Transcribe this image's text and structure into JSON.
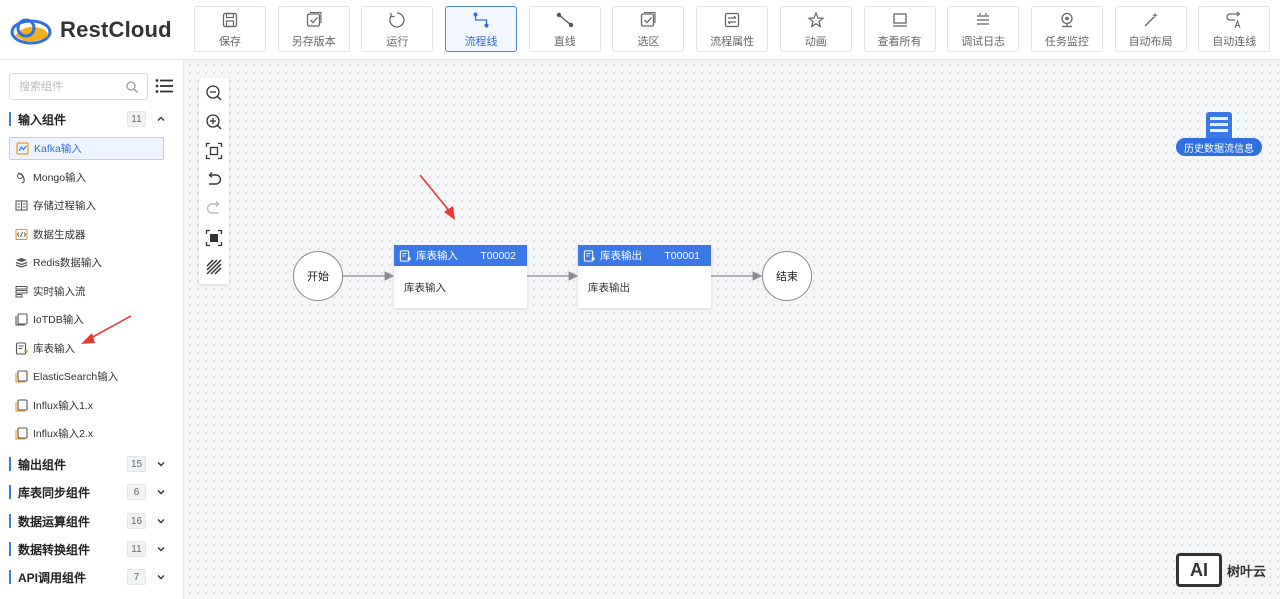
{
  "app": {
    "brand": "RestCloud",
    "accent": "#3b78e7"
  },
  "toolbar": [
    {
      "key": "save",
      "label": "保存",
      "icon": "save-icon"
    },
    {
      "key": "save-version",
      "label": "另存版本",
      "icon": "version-icon"
    },
    {
      "key": "run",
      "label": "运行",
      "icon": "run-icon"
    },
    {
      "key": "flow-line",
      "label": "流程线",
      "icon": "flow-line-icon",
      "active": true
    },
    {
      "key": "straight-line",
      "label": "直线",
      "icon": "straight-line-icon"
    },
    {
      "key": "select-area",
      "label": "选区",
      "icon": "select-area-icon"
    },
    {
      "key": "flow-props",
      "label": "流程属性",
      "icon": "flow-props-icon"
    },
    {
      "key": "animation",
      "label": "动画",
      "icon": "star-icon"
    },
    {
      "key": "view-all",
      "label": "查看所有",
      "icon": "view-all-icon"
    },
    {
      "key": "debug-log",
      "label": "调试日志",
      "icon": "log-icon"
    },
    {
      "key": "task-monitor",
      "label": "任务监控",
      "icon": "monitor-icon"
    },
    {
      "key": "auto-layout",
      "label": "自动布局",
      "icon": "magic-wand-icon"
    },
    {
      "key": "auto-connect",
      "label": "自动连线",
      "icon": "auto-connect-icon"
    }
  ],
  "sidebar": {
    "search_placeholder": "搜索组件",
    "groups": [
      {
        "name": "输入组件",
        "count": "11",
        "expanded": true
      },
      {
        "name": "输出组件",
        "count": "15"
      },
      {
        "name": "库表同步组件",
        "count": "6"
      },
      {
        "name": "数据运算组件",
        "count": "16"
      },
      {
        "name": "数据转换组件",
        "count": "11"
      },
      {
        "name": "API调用组件",
        "count": "7"
      }
    ],
    "input_items": [
      {
        "name": "Kafka输入",
        "icon": "kafka-icon",
        "selected": true
      },
      {
        "name": "Mongo输入",
        "icon": "mongo-icon"
      },
      {
        "name": "存储过程输入",
        "icon": "procedure-icon"
      },
      {
        "name": "数据生成器",
        "icon": "generator-icon"
      },
      {
        "name": "Redis数据输入",
        "icon": "redis-icon"
      },
      {
        "name": "实时输入流",
        "icon": "stream-icon"
      },
      {
        "name": "IoTDB输入",
        "icon": "iotdb-icon"
      },
      {
        "name": "库表输入",
        "icon": "table-input-icon"
      },
      {
        "name": "ElasticSearch输入",
        "icon": "elasticsearch-icon"
      },
      {
        "name": "Influx输入1.x",
        "icon": "influx-icon"
      },
      {
        "name": "Influx输入2.x",
        "icon": "influx-icon"
      }
    ]
  },
  "flow": {
    "start_label": "开始",
    "end_label": "结束",
    "nodes": [
      {
        "title": "库表输入",
        "id": "T00002",
        "body": "库表输入"
      },
      {
        "title": "库表输出",
        "id": "T00001",
        "body": "库表输出"
      }
    ]
  },
  "history": {
    "label": "历史数据流信息"
  },
  "watermark": {
    "badge": "AI",
    "text": "树叶云"
  }
}
